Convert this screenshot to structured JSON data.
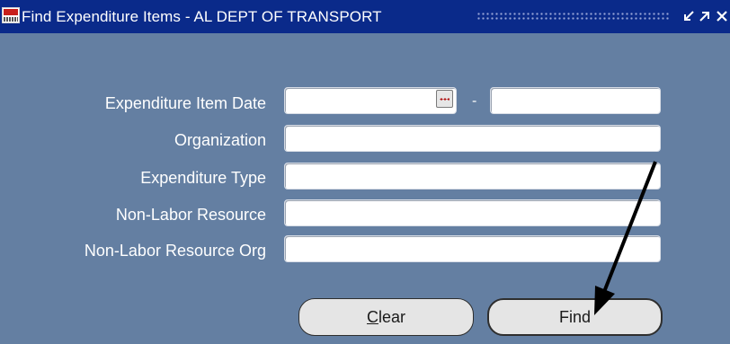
{
  "window": {
    "title": "Find Expenditure Items - AL DEPT OF TRANSPORT",
    "controls": {
      "minimize_glyph": "⌄",
      "maximize_glyph": "↗",
      "close_glyph": "✕"
    }
  },
  "form": {
    "fields": [
      {
        "label": "Expenditure Item Date",
        "value": "",
        "value_to": ""
      },
      {
        "label": "Organization",
        "value": ""
      },
      {
        "label": "Expenditure Type",
        "value": ""
      },
      {
        "label": "Non-Labor Resource",
        "value": ""
      },
      {
        "label": "Non-Labor Resource Org",
        "value": ""
      }
    ],
    "date_range_separator": "-"
  },
  "buttons": {
    "clear_prefix": "C",
    "clear_rest": "lear",
    "find_label": "Find"
  },
  "colors": {
    "window_bg": "#647fa2",
    "titlebar_bg": "#0a2a8a",
    "field_bg": "#ffffff",
    "button_bg": "#e5e5e5",
    "annotation_arrow": "#000000"
  },
  "icons": {
    "app_logo": "oracle-logo-icon",
    "list_of_values": "lov-ellipsis-icon",
    "annotation": "arrow-pointer-icon"
  }
}
